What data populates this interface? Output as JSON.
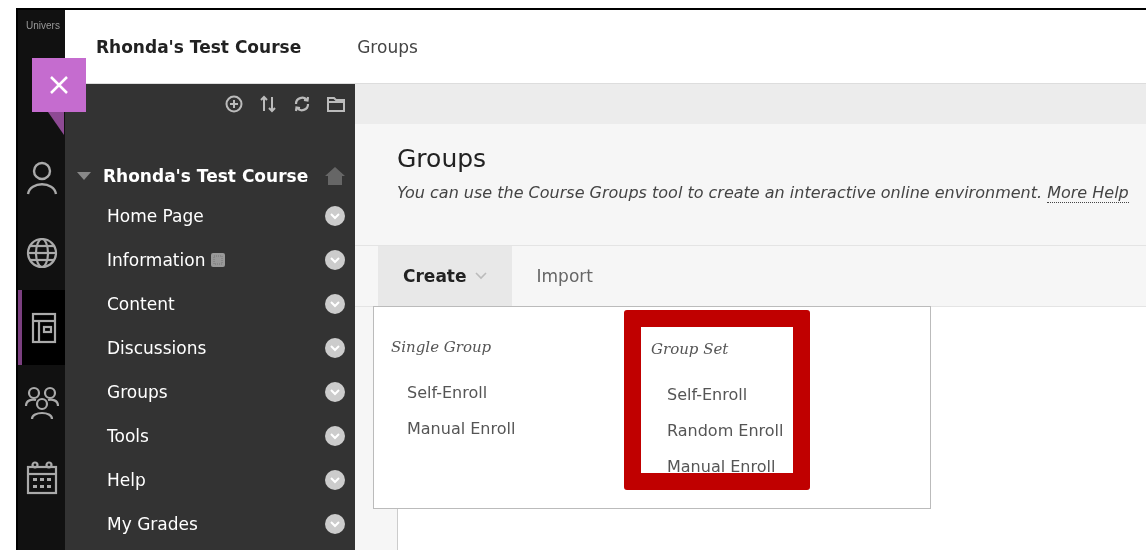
{
  "header": {
    "course_title": "Rhonda's Test Course",
    "page": "Groups"
  },
  "rail": {
    "brand": "Univers",
    "items": [
      {
        "kind": "person",
        "selected": false
      },
      {
        "kind": "globe",
        "selected": false
      },
      {
        "kind": "course",
        "selected": true
      },
      {
        "kind": "groups",
        "selected": false
      },
      {
        "kind": "calendar",
        "selected": false
      }
    ]
  },
  "course_menu": {
    "title": "Rhonda's Test Course",
    "expanded": true,
    "items": [
      {
        "label": "Home Page",
        "page_icon": false
      },
      {
        "label": "Information",
        "page_icon": true
      },
      {
        "label": "Content",
        "page_icon": false
      },
      {
        "label": "Discussions",
        "page_icon": false
      },
      {
        "label": "Groups",
        "page_icon": false
      },
      {
        "label": "Tools",
        "page_icon": false
      },
      {
        "label": "Help",
        "page_icon": false
      },
      {
        "label": "My Grades",
        "page_icon": false
      }
    ]
  },
  "content": {
    "title": "Groups",
    "description": "You can use the Course Groups tool to create an interactive online environment.",
    "help_link": "More Help",
    "actions": [
      {
        "label": "Create",
        "selected": true,
        "menu": true
      },
      {
        "label": "Import",
        "selected": false,
        "menu": false
      }
    ],
    "dropdown": [
      {
        "heading": "Single Group",
        "highlighted": false,
        "items": [
          "Self-Enroll",
          "Manual Enroll"
        ]
      },
      {
        "heading": "Group Set",
        "highlighted": true,
        "items": [
          "Self-Enroll",
          "Random Enroll",
          "Manual Enroll"
        ]
      }
    ]
  }
}
